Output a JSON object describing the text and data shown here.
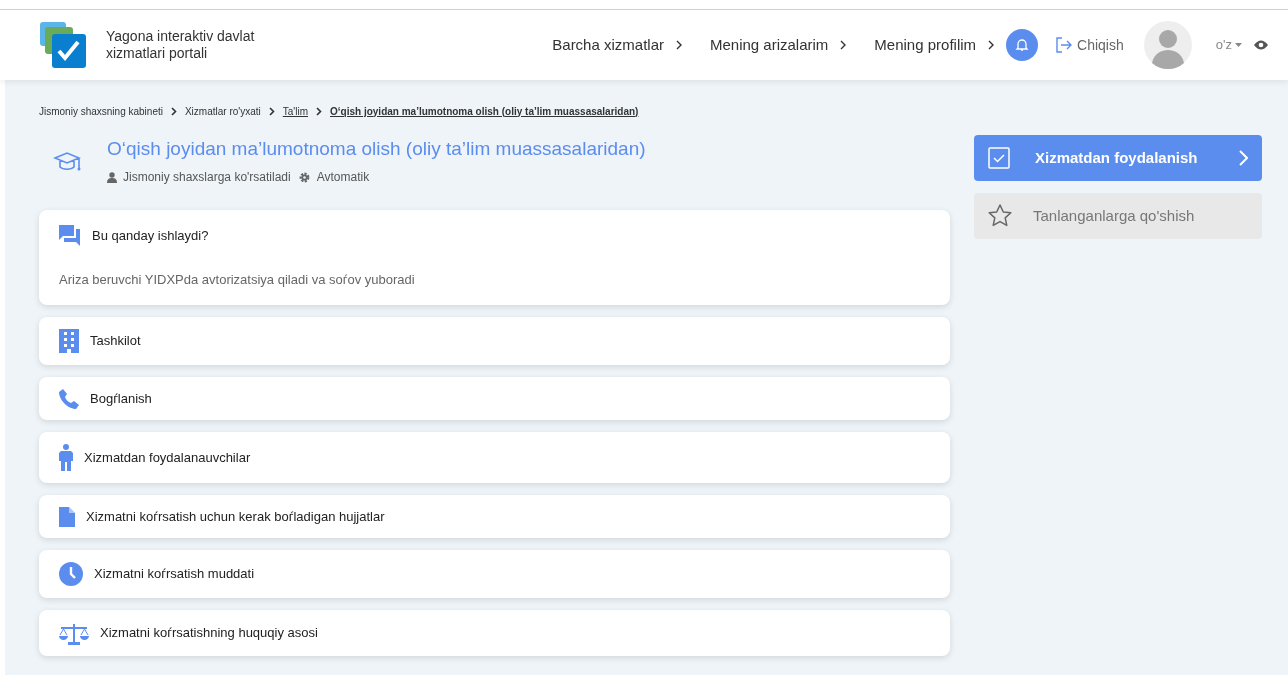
{
  "header": {
    "portal_name": "Yagona interaktiv davlat xizmatlari portali",
    "nav": [
      "Barcha xizmatlar",
      "Mening arizalarim",
      "Mening profilim"
    ],
    "logout": "Chiqish",
    "language": "o'z"
  },
  "breadcrumbs": [
    {
      "label": "Jismoniy shaxsning kabineti",
      "link": false
    },
    {
      "label": "Xizmatlar ro'yxati",
      "link": false
    },
    {
      "label": "Ta'lim",
      "link": true
    },
    {
      "label": "O‘qish joyidan ma’lumotnoma olish (oliy ta’lim muassasalaridan)",
      "link": true
    }
  ],
  "service": {
    "title": "O‘qish joyidan ma’lumotnoma olish (oliy ta’lim muassasalaridan)",
    "audience": "Jismoniy shaxslarga ko'rsatiladi",
    "mode": "Avtomatik"
  },
  "sections": [
    {
      "kind": "chat",
      "title": "Bu qanday ishlaydi?",
      "text": "Ariza beruvchi YIDXPda avtorizatsiya qiladi va soѓov yuboradi"
    },
    {
      "kind": "building",
      "title": "Tashkilot"
    },
    {
      "kind": "phone",
      "title": "Bogѓlanish"
    },
    {
      "kind": "person",
      "title": "Xizmatdan foydalanauvchilar"
    },
    {
      "kind": "document",
      "title": "Xizmatni koѓrsatish uchun kerak boѓladigan hujjatlar"
    },
    {
      "kind": "clock",
      "title": "Xizmatni koѓrsatish muddati"
    },
    {
      "kind": "scales",
      "title": "Xizmatni koѓrsatishning huquqiy asosi"
    }
  ],
  "actions": {
    "primary": "Xizmatdan foydalanish",
    "favorite": "Tanlanganlarga qo'shish"
  }
}
